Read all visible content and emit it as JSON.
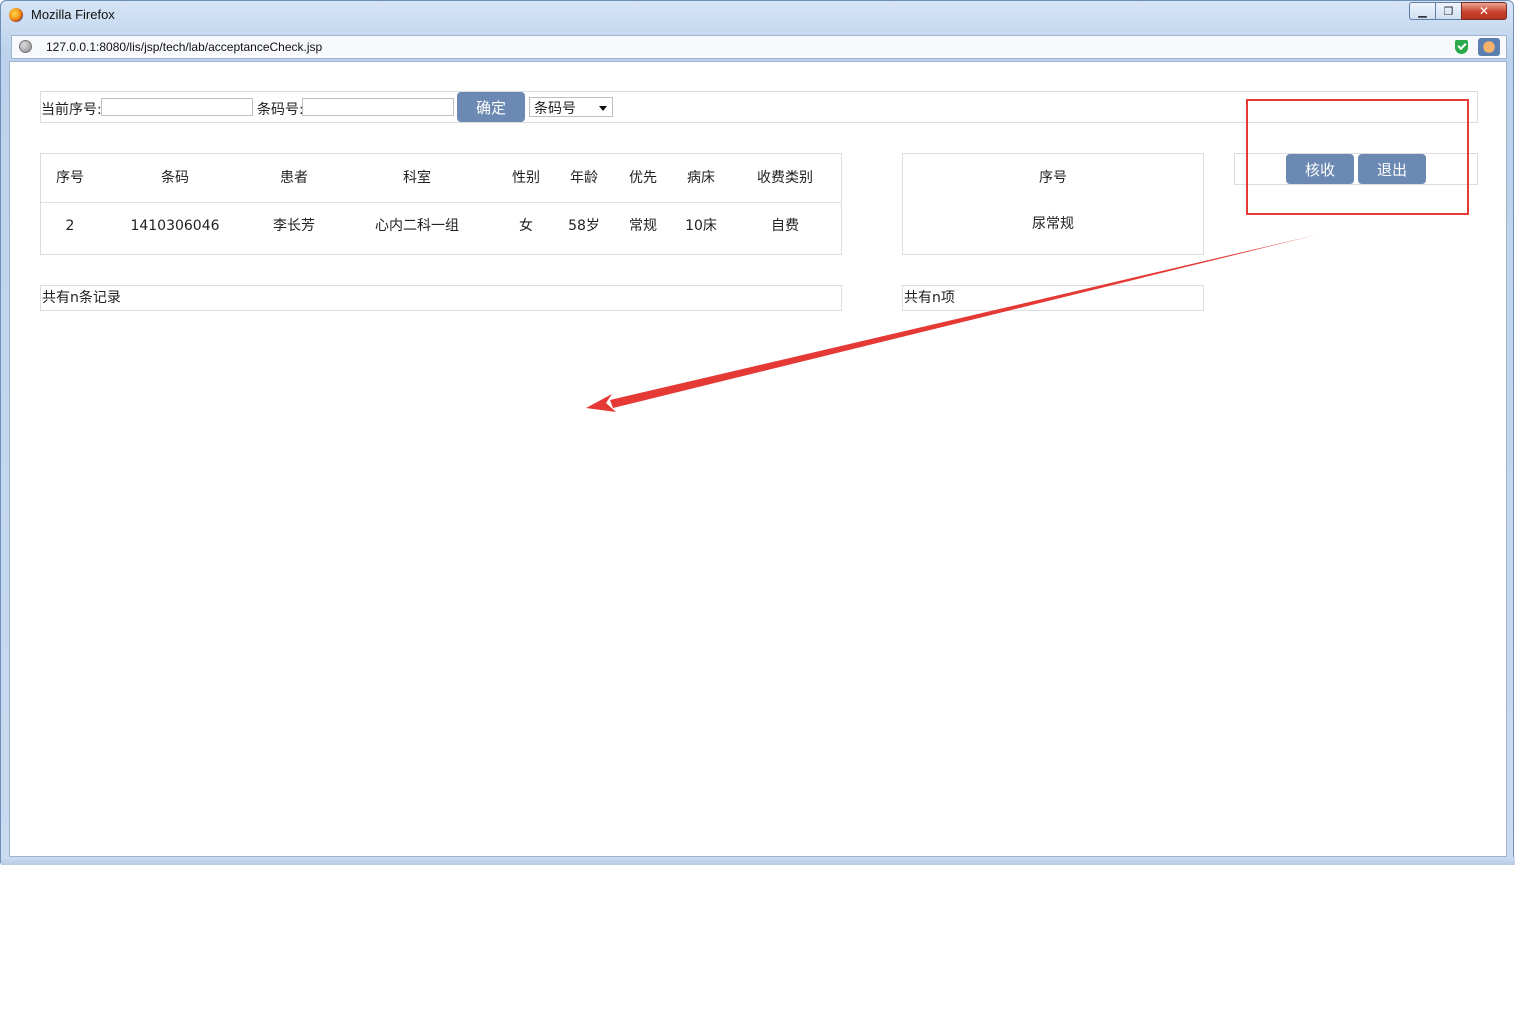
{
  "window": {
    "title": "Mozilla Firefox",
    "controls": {
      "minimize": "▁",
      "restore": "❐",
      "close": "✕"
    },
    "url": "127.0.0.1:8080/lis/jsp/tech/lab/acceptanceCheck.jsp"
  },
  "search": {
    "current_seq_label": "当前序号:",
    "current_seq_value": "",
    "barcode_label": "条码号:",
    "barcode_value": "",
    "confirm_button": "确定",
    "mode_select_value": "条码号"
  },
  "patients_table": {
    "columns": [
      "序号",
      "条码",
      "患者",
      "科室",
      "性别",
      "年龄",
      "优先",
      "病床",
      "收费类别"
    ],
    "rows": [
      [
        "2",
        "1410306046",
        "李长芳",
        "心内二科一组",
        "女",
        "58岁",
        "常规",
        "10床",
        "自费"
      ]
    ],
    "footer": "共有n条记录"
  },
  "items_table": {
    "columns": [
      "序号"
    ],
    "rows": [
      [
        "尿常规"
      ]
    ],
    "footer": "共有n项"
  },
  "actions": {
    "accept_button": "核收",
    "exit_button": "退出"
  },
  "annotation": {
    "color": "#e53935"
  }
}
